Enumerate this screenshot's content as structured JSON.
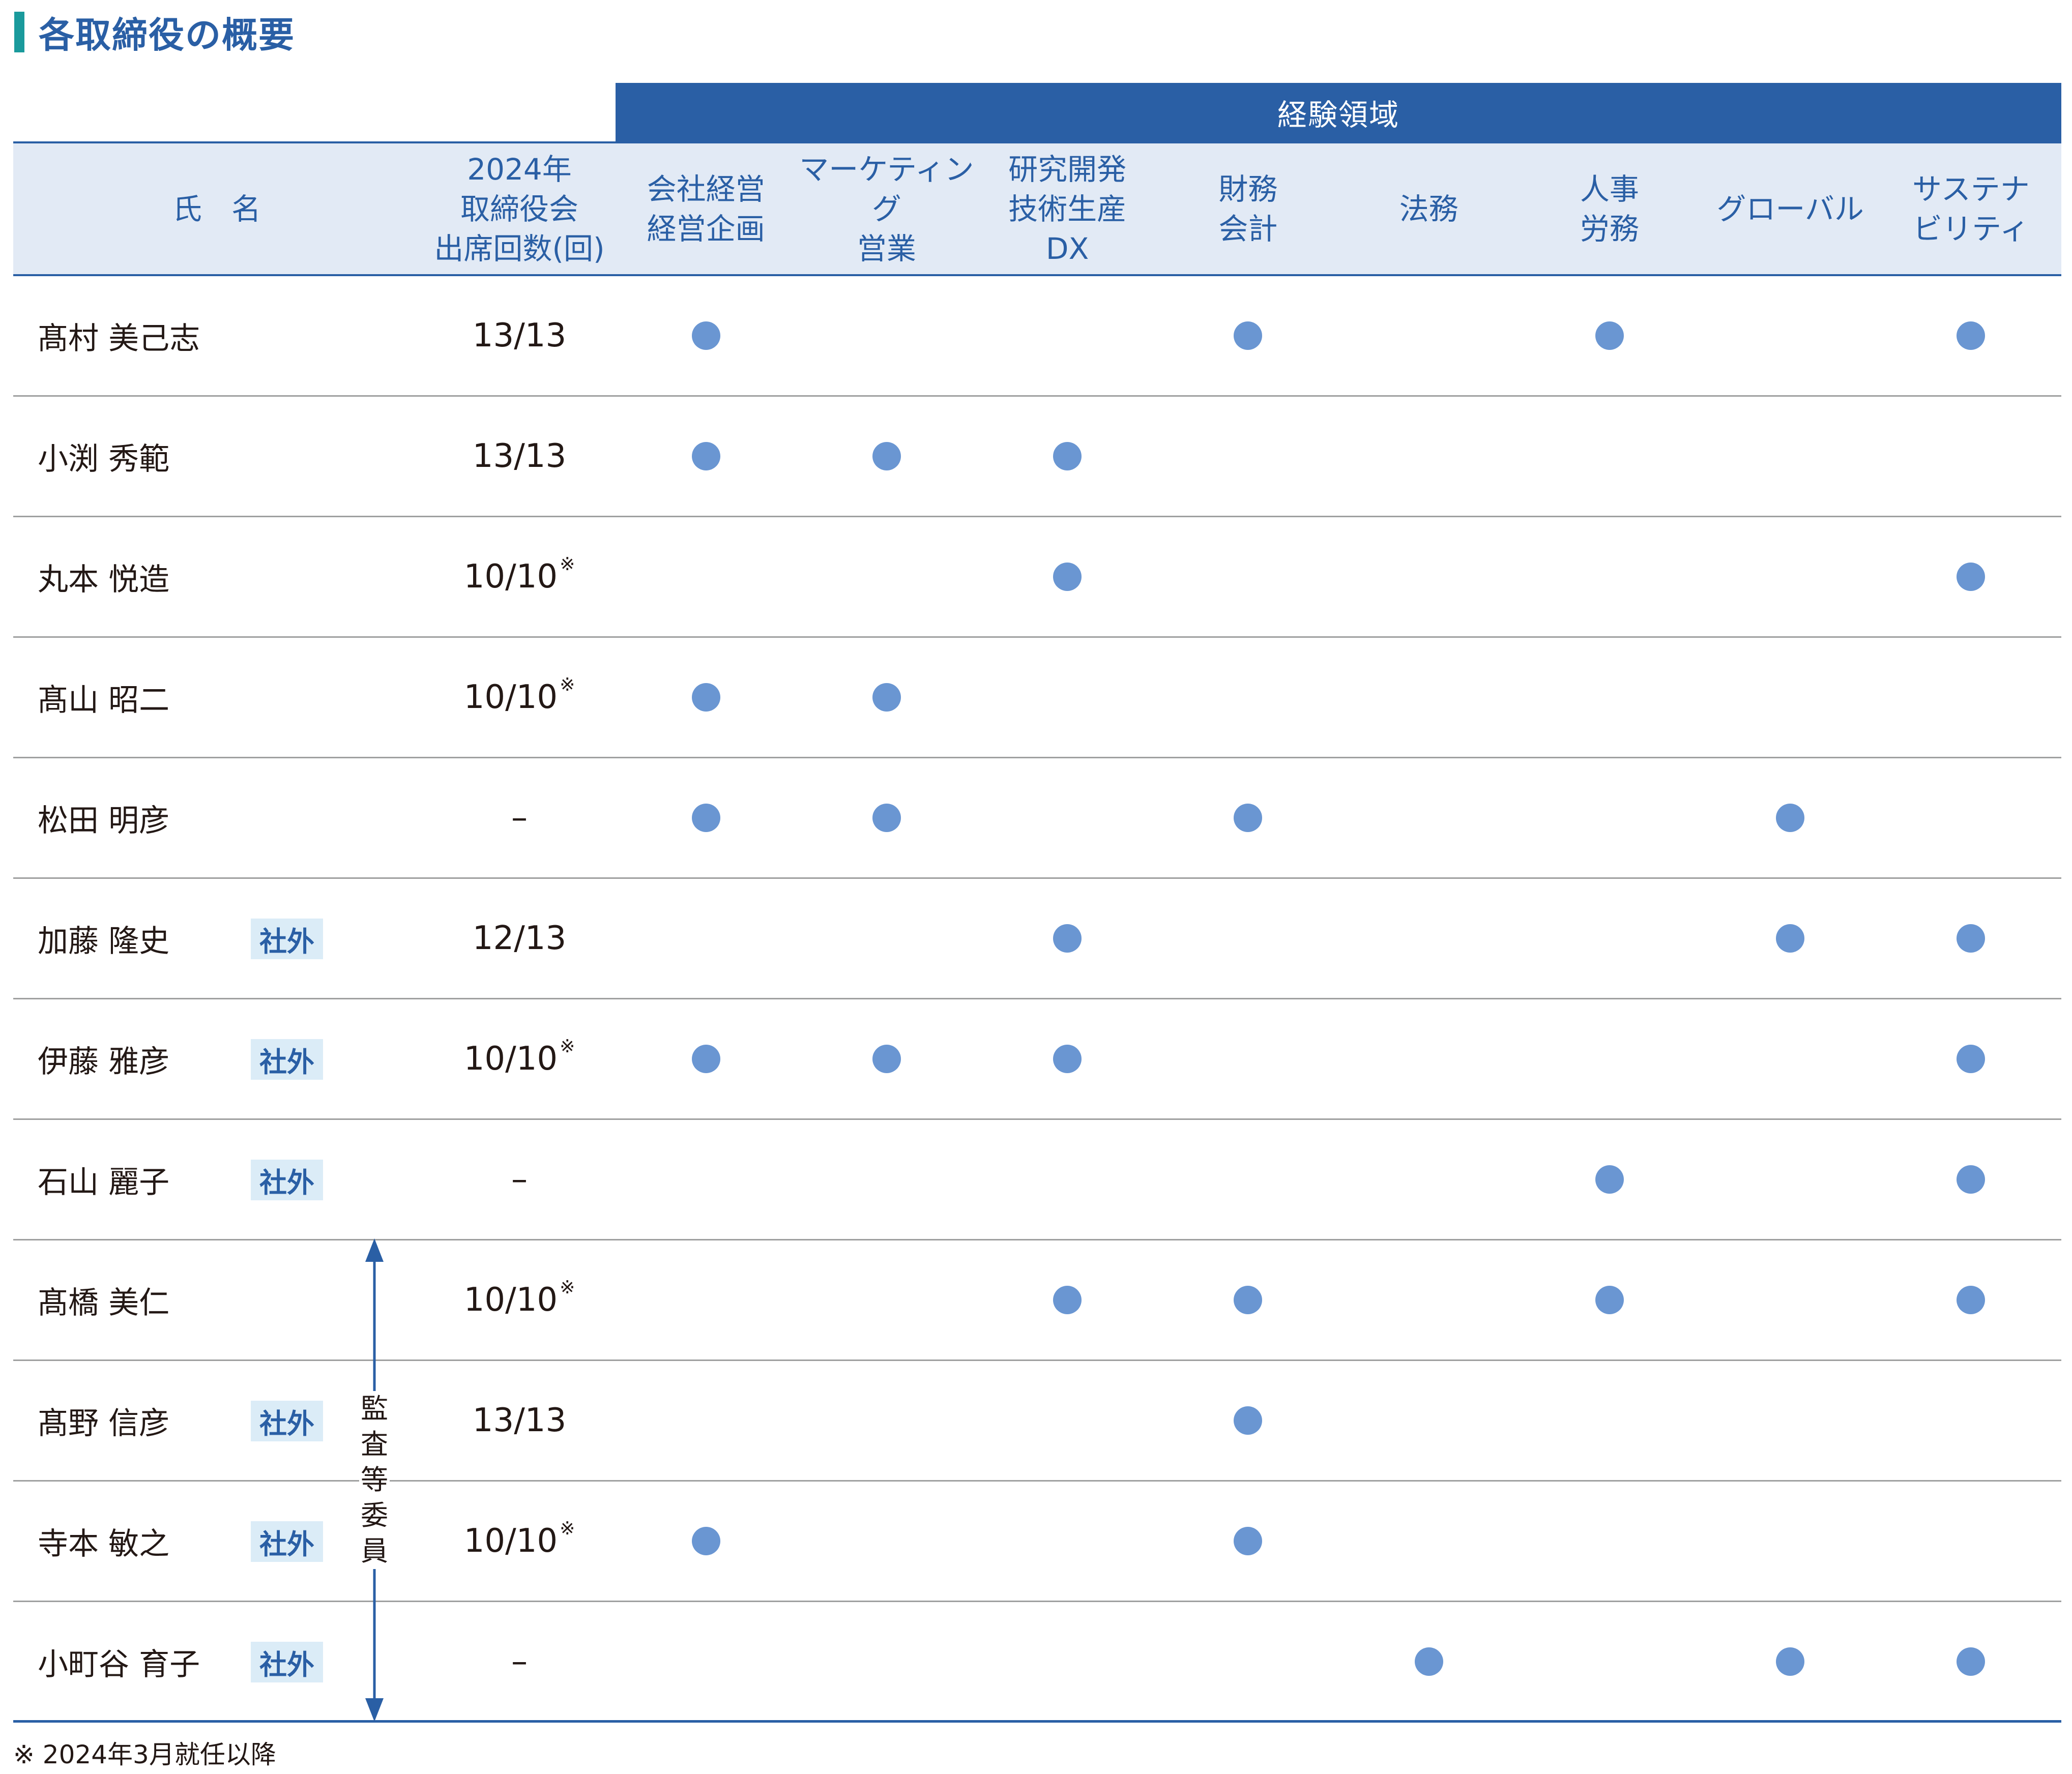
{
  "title": "各取締役の概要",
  "band_label": "経験領域",
  "headers": {
    "name": "氏　名",
    "attendance": "2024年\n取締役会\n出席回数(回)",
    "areas": [
      "会社経営\n経営企画",
      "マーケティング\n営業",
      "研究開発\n技術生産\nDX",
      "財務\n会計",
      "法務",
      "人事\n労務",
      "グローバル",
      "サステナ\nビリティ"
    ]
  },
  "rows": [
    {
      "name": "髙村 美己志",
      "tag": "",
      "attendance": "13/13",
      "mark": "",
      "exp": [
        1,
        0,
        0,
        1,
        0,
        1,
        0,
        1
      ]
    },
    {
      "name": "小渕 秀範",
      "tag": "",
      "attendance": "13/13",
      "mark": "",
      "exp": [
        1,
        1,
        1,
        0,
        0,
        0,
        0,
        0
      ]
    },
    {
      "name": "丸本 悦造",
      "tag": "",
      "attendance": "10/10",
      "mark": "※",
      "exp": [
        0,
        0,
        1,
        0,
        0,
        0,
        0,
        1
      ]
    },
    {
      "name": "髙山 昭二",
      "tag": "",
      "attendance": "10/10",
      "mark": "※",
      "exp": [
        1,
        1,
        0,
        0,
        0,
        0,
        0,
        0
      ]
    },
    {
      "name": "松田 明彦",
      "tag": "",
      "attendance": "–",
      "mark": "",
      "exp": [
        1,
        1,
        0,
        1,
        0,
        0,
        1,
        0
      ]
    },
    {
      "name": "加藤 隆史",
      "tag": "社外",
      "attendance": "12/13",
      "mark": "",
      "exp": [
        0,
        0,
        1,
        0,
        0,
        0,
        1,
        1
      ]
    },
    {
      "name": "伊藤 雅彦",
      "tag": "社外",
      "attendance": "10/10",
      "mark": "※",
      "exp": [
        1,
        1,
        1,
        0,
        0,
        0,
        0,
        1
      ]
    },
    {
      "name": "石山 麗子",
      "tag": "社外",
      "attendance": "–",
      "mark": "",
      "exp": [
        0,
        0,
        0,
        0,
        0,
        1,
        0,
        1
      ]
    },
    {
      "name": "髙橋 美仁",
      "tag": "",
      "attendance": "10/10",
      "mark": "※",
      "exp": [
        0,
        0,
        1,
        1,
        0,
        1,
        0,
        1
      ]
    },
    {
      "name": "髙野 信彦",
      "tag": "社外",
      "attendance": "13/13",
      "mark": "",
      "exp": [
        0,
        0,
        0,
        1,
        0,
        0,
        0,
        0
      ]
    },
    {
      "name": "寺本 敏之",
      "tag": "社外",
      "attendance": "10/10",
      "mark": "※",
      "exp": [
        1,
        0,
        0,
        1,
        0,
        0,
        0,
        0
      ]
    },
    {
      "name": "小町谷 育子",
      "tag": "社外",
      "attendance": "–",
      "mark": "",
      "exp": [
        0,
        0,
        0,
        0,
        1,
        0,
        1,
        1
      ]
    }
  ],
  "audit_label": "監\n査\n等\n委\n員",
  "footnote": "※ 2024年3月就任以降",
  "colors": {
    "accent": "#2a5fa5",
    "dot": "#6a96d2",
    "title_bar": "#1a9a9c",
    "header_bg": "#e2eaf5",
    "tag_bg": "#dbecf7"
  }
}
